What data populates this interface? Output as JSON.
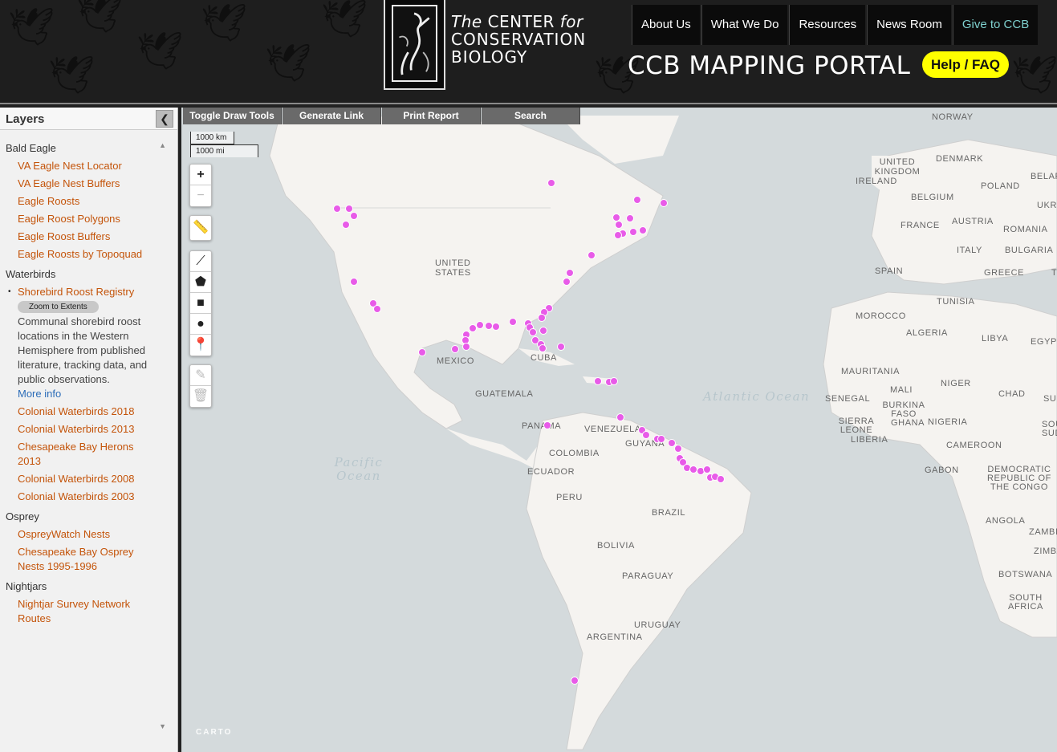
{
  "header": {
    "org_line1_italic": "The",
    "org_line1": "CENTER",
    "org_line1_italic2": "for",
    "org_line2": "CONSERVATION",
    "org_line3": "BIOLOGY",
    "portal_title": "CCB MAPPING PORTAL",
    "help_label": "Help / FAQ",
    "nav": [
      "About Us",
      "What We Do",
      "Resources",
      "News Room",
      "Give to CCB"
    ],
    "colors": {
      "background": "#1e1e1e",
      "help": "#ffff00",
      "give_link": "#7fd1cf"
    }
  },
  "sidebar": {
    "title": "Layers",
    "collapse_icon": "chevron-left-icon",
    "groups": [
      {
        "name": "Bald Eagle",
        "layers": [
          "VA Eagle Nest Locator",
          "VA Eagle Nest Buffers",
          "Eagle Roosts",
          "Eagle Roost Polygons",
          "Eagle Roost Buffers",
          "Eagle Roosts by Topoquad"
        ]
      },
      {
        "name": "Waterbirds",
        "layers": [
          "Shorebird Roost Registry",
          "Colonial Waterbirds 2018",
          "Colonial Waterbirds 2013",
          "Chesapeake Bay Herons 2013",
          "Colonial Waterbirds 2008",
          "Colonial Waterbirds 2003"
        ]
      },
      {
        "name": "Osprey",
        "layers": [
          "OspreyWatch Nests",
          "Chesapeake Bay Osprey Nests 1995-1996"
        ]
      },
      {
        "name": "Nightjars",
        "layers": [
          "Nightjar Survey Network Routes"
        ]
      }
    ],
    "active_layer": {
      "zoom_label": "Zoom to Extents",
      "description": "Communal shorebird roost locations in the Western Hemisphere from published literature, tracking data, and public observations.",
      "more_info": "More info"
    },
    "layer_color": "#c4540a"
  },
  "map": {
    "toolbar": [
      "Toggle Draw Tools",
      "Generate Link",
      "Print Report",
      "Search"
    ],
    "scale": {
      "km": "1000 km",
      "mi": "1000 mi"
    },
    "zoom_in": "+",
    "zoom_out": "−",
    "attribution": "CARTO",
    "point_color": "#e85be8",
    "labels": [
      "NORWAY",
      "UNITED KINGDOM",
      "IRELAND",
      "DENMARK",
      "BELARUS",
      "POLAND",
      "UKRA",
      "BELGIUM",
      "FRANCE",
      "AUSTRIA",
      "ROMANIA",
      "ITALY",
      "BULGARIA",
      "SPAIN",
      "GREECE",
      "T",
      "TUNISIA",
      "MOROCCO",
      "ALGERIA",
      "LIBYA",
      "EGYP",
      "MAURITANIA",
      "MALI",
      "NIGER",
      "CHAD",
      "SUDA",
      "SENEGAL",
      "BURKINA FASO",
      "NIGERIA",
      "SIERRA LEONE",
      "GHANA",
      "LIBERIA",
      "SOUTH SUDA",
      "CAMEROON",
      "GABON",
      "DEMOCRATIC REPUBLIC OF THE CONGO",
      "ANGOLA",
      "ZAMBIA",
      "ZIMBAB",
      "BOTSWANA",
      "SOUTH AFRICA",
      "UNITED STATES",
      "MEXICO",
      "CUBA",
      "GUATEMALA",
      "PANAMA",
      "VENEZUELA",
      "GUYANA",
      "COLOMBIA",
      "ECUADOR",
      "PERU",
      "BRAZIL",
      "BOLIVIA",
      "PARAGUAY",
      "URUGUAY",
      "ARGENTINA"
    ],
    "oceans": [
      "Atlantic Ocean",
      "Pacific Ocean"
    ]
  }
}
